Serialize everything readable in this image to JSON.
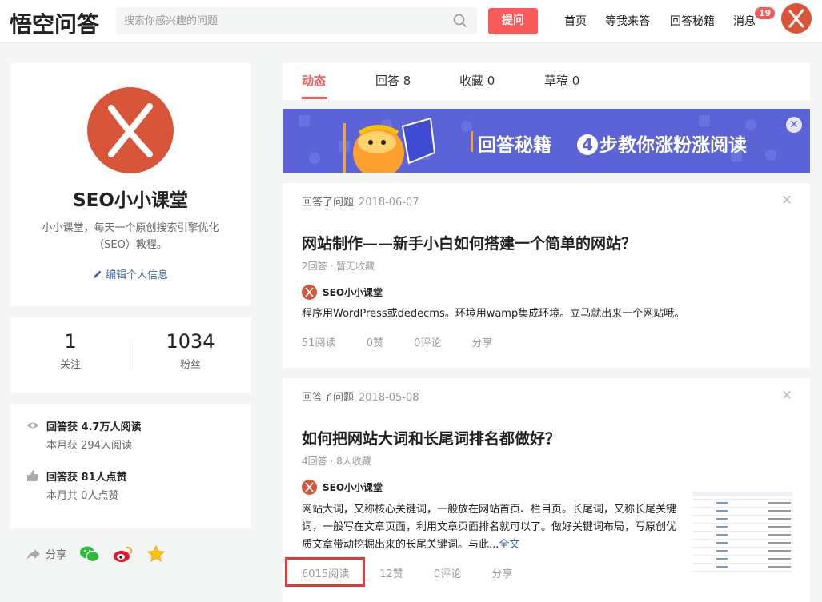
{
  "header": {
    "logo_text": "悟空问答",
    "search_placeholder": "搜索你感兴趣的问题",
    "ask_button": "提问",
    "nav": [
      "首页",
      "等我来答",
      "回答秘籍",
      "消息"
    ],
    "message_badge": "19"
  },
  "profile": {
    "name": "SEO小小课堂",
    "bio": "小小课堂，每天一个原创搜索引擎优化（SEO）教程。",
    "edit_label": "编辑个人信息"
  },
  "stats": {
    "follow_num": "1",
    "follow_label": "关注",
    "fans_num": "1034",
    "fans_label": "粉丝"
  },
  "achievements": {
    "reads_main": "回答获 4.7万人阅读",
    "reads_sub": "本月获 294人阅读",
    "likes_main": "回答获 81人点赞",
    "likes_sub": "本月共 0人点赞"
  },
  "share": {
    "label": "分享"
  },
  "tabs": [
    "动态",
    "回答 8",
    "收藏 0",
    "草稿 0"
  ],
  "banner": {
    "text_left": "回答秘籍",
    "num": "4",
    "text_right": "步教你涨粉涨阅读"
  },
  "feed": [
    {
      "action": "回答了问题",
      "date": "2018-06-07",
      "title": "网站制作——新手小白如何搭建一个简单的网站？",
      "sub": "2回答 · 暂无收藏",
      "author": "SEO小小课堂",
      "answer": "程序用WordPress或dedecms。环境用wamp集成环境。立马就出来一个网站哦。",
      "reads": "51阅读",
      "likes": "0赞",
      "comments": "0评论",
      "share": "分享"
    },
    {
      "action": "回答了问题",
      "date": "2018-05-08",
      "title": "如何把网站大词和长尾词排名都做好？",
      "sub": "4回答 · 8人收藏",
      "author": "SEO小小课堂",
      "answer": "网站大词，又称核心关键词，一般放在网站首页、栏目页。长尾词，又称长尾关键词，一般写在文章页面，利用文章页面排名就可以了。做好关键词布局，写原创优质文章带动挖掘出来的长尾关键词。与此...",
      "more": "全文",
      "reads": "6015阅读",
      "likes": "12赞",
      "comments": "0评论",
      "share": "分享"
    }
  ],
  "colors": {
    "accent": "#f85959",
    "avatar": "#d9553a",
    "banner": "#5b63d6",
    "link": "#406599",
    "highlight": "#e53935"
  }
}
